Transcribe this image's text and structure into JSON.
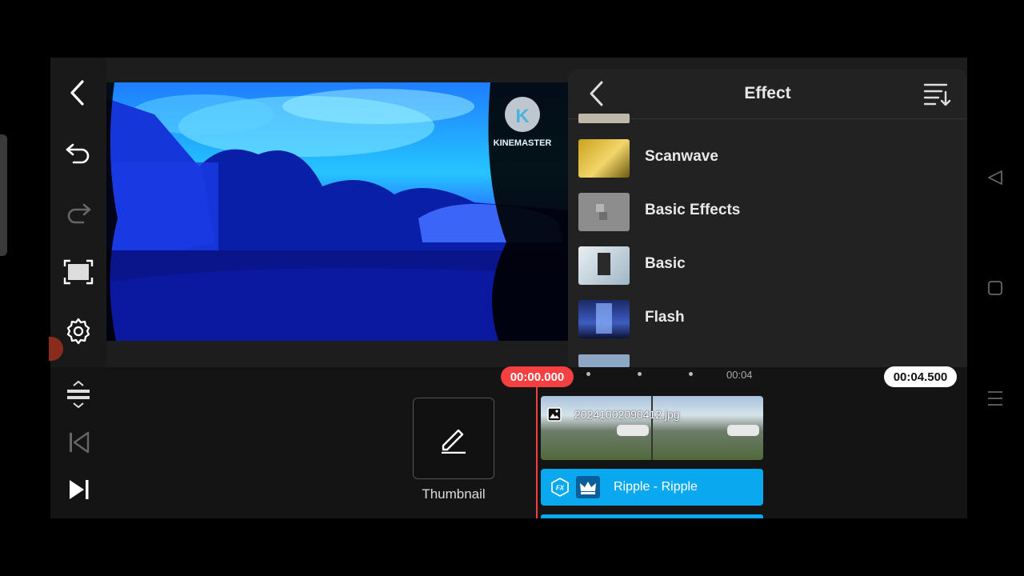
{
  "preview": {
    "watermark": "KINEMASTER",
    "watermark_letter": "K"
  },
  "panel": {
    "title": "Effect",
    "items": [
      {
        "label": "Scanwave"
      },
      {
        "label": "Basic Effects"
      },
      {
        "label": "Basic"
      },
      {
        "label": "Flash"
      }
    ]
  },
  "timeline": {
    "current_time": "00:00.000",
    "tick_label": "00:04",
    "end_time": "00:04.500",
    "thumbnail_label": "Thumbnail",
    "clip_filename": "20241002090412.jpg",
    "effect_clip_label": "Ripple - Ripple"
  },
  "colors": {
    "accent": "#0aa8ef",
    "playhead": "#f44040",
    "preview_tint": "#1e3cff"
  },
  "icons": [
    "back-arrow-icon",
    "undo-icon",
    "redo-icon",
    "fullscreen-icon",
    "settings-icon",
    "layer-toggle-icon",
    "skip-start-icon",
    "skip-end-icon",
    "sort-icon",
    "pencil-icon",
    "image-icon",
    "fx-icon",
    "crown-icon",
    "nav-back-icon",
    "nav-home-icon",
    "nav-menu-icon"
  ]
}
